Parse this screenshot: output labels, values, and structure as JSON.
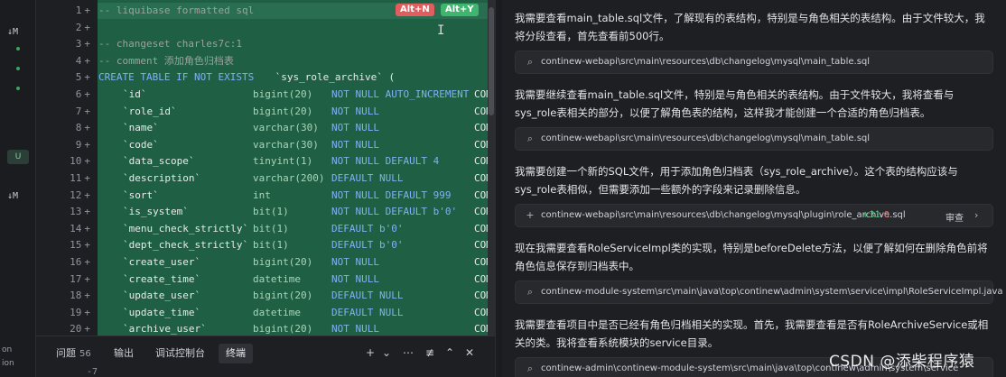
{
  "sidebar": {
    "labels": [
      "↓M",
      "U",
      "↓M",
      "on",
      "ion"
    ]
  },
  "editor": {
    "line_numbers": [
      "1",
      "2",
      "3",
      "4",
      "5",
      "6",
      "7",
      "8",
      "9",
      "10",
      "11",
      "12",
      "13",
      "14",
      "15",
      "16",
      "17",
      "18",
      "19",
      "20"
    ],
    "plus_mark": "+",
    "badges": {
      "alt_n": "Alt+N",
      "alt_y": "Alt+Y"
    },
    "lines": [
      {
        "comment": "-- liquibase formatted sql"
      },
      {
        "comment": ""
      },
      {
        "comment": "-- changeset charles7c:1"
      },
      {
        "comment": "-- comment 添加角色归档表"
      },
      {
        "create": "CREATE TABLE IF NOT EXISTS",
        "name": " `sys_role_archive` ("
      },
      {
        "col": "`id`",
        "type": "bigint(20)",
        "cons": "NOT NULL AUTO_INCREMENT",
        "tail": "COM"
      },
      {
        "col": "`role_id`",
        "type": "bigint(20)",
        "cons": "NOT NULL",
        "tail": "COM"
      },
      {
        "col": "`name`",
        "type": "varchar(30)",
        "cons": "NOT NULL",
        "tail": "COM"
      },
      {
        "col": "`code`",
        "type": "varchar(30)",
        "cons": "NOT NULL",
        "tail": "COM"
      },
      {
        "col": "`data_scope`",
        "type": "tinyint(1)",
        "cons": "NOT NULL DEFAULT 4",
        "tail": "COM"
      },
      {
        "col": "`description`",
        "type": "varchar(200)",
        "cons": "DEFAULT NULL",
        "tail": "COM"
      },
      {
        "col": "`sort`",
        "type": "int",
        "cons": "NOT NULL DEFAULT 999",
        "tail": "COM"
      },
      {
        "col": "`is_system`",
        "type": "bit(1)",
        "cons": "NOT NULL DEFAULT b'0'",
        "tail": "COM"
      },
      {
        "col": "`menu_check_strictly`",
        "type": "bit(1)",
        "cons": "DEFAULT b'0'",
        "tail": "COM"
      },
      {
        "col": "`dept_check_strictly`",
        "type": "bit(1)",
        "cons": "DEFAULT b'0'",
        "tail": "COM"
      },
      {
        "col": "`create_user`",
        "type": "bigint(20)",
        "cons": "NOT NULL",
        "tail": "COM"
      },
      {
        "col": "`create_time`",
        "type": "datetime",
        "cons": "NOT NULL",
        "tail": "COM"
      },
      {
        "col": "`update_user`",
        "type": "bigint(20)",
        "cons": "DEFAULT NULL",
        "tail": "COM"
      },
      {
        "col": "`update_time`",
        "type": "datetime",
        "cons": "DEFAULT NULL",
        "tail": "COM"
      },
      {
        "col": "`archive_user`",
        "type": "bigint(20)",
        "cons": "NOT NULL",
        "tail": "COM"
      }
    ]
  },
  "panel": {
    "tabs": [
      {
        "label": "问题",
        "count": "56"
      },
      {
        "label": "输出"
      },
      {
        "label": "调试控制台"
      },
      {
        "label": "终端"
      }
    ],
    "prompt": "-7"
  },
  "chat": {
    "paragraphs": [
      "我需要查看main_table.sql文件，了解现有的表结构，特别是与角色相关的表结构。由于文件较大，我将分段查看，首先查看前500行。",
      "我需要继续查看main_table.sql文件，特别是与角色相关的表结构。由于文件较大，我将查看与sys_role表相关的部分，以便了解角色表的结构，这样我才能创建一个合适的角色归档表。",
      "我需要创建一个新的SQL文件，用于添加角色归档表（sys_role_archive）。这个表的结构应该与sys_role表相似，但需要添加一些额外的字段来记录删除信息。",
      "现在我需要查看RoleServiceImpl类的实现，特别是beforeDelete方法，以便了解如何在删除角色前将角色信息保存到归档表中。",
      "我需要查看项目中是否已经有角色归档相关的实现。首先，我需要查看是否有RoleArchiveService或相关的类。我将查看系统模块的service目录。"
    ],
    "files": [
      "continew-webapi\\src\\main\\resources\\db\\changelog\\mysql\\main_table.sql",
      "continew-webapi\\src\\main\\resources\\db\\changelog\\mysql\\main_table.sql",
      "continew-webapi\\src\\main\\resources\\db\\changelog\\mysql\\plugin\\role_archive.sql",
      "continew-module-system\\src\\main\\java\\top\\continew\\admin\\system\\service\\impl\\RoleServiceImpl.java",
      "continew-admin\\continew-module-system\\src\\main\\java\\top\\continew\\admin\\system\\service"
    ],
    "diff": {
      "added": "+31",
      "removed": "-0",
      "review": "审查"
    },
    "watermark": "CSDN @添柴程序猿"
  },
  "colors": {
    "editor_bg": "#1f5f44",
    "accent_add": "#4bc17a",
    "accent_del": "#e26d6d"
  }
}
